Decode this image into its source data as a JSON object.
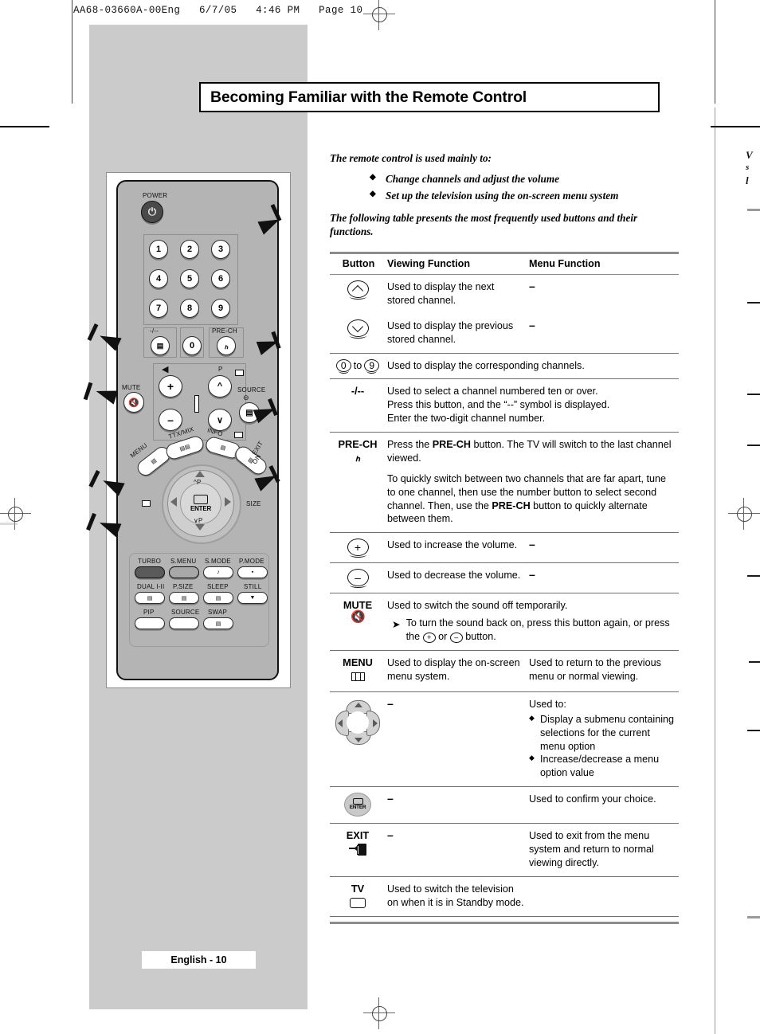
{
  "header_slug": "AA68-03660A-00Eng   6/7/05   4:46 PM   Page 10",
  "title": "Becoming Familiar with the Remote Control",
  "intro": {
    "lead": "The remote control is used mainly to:",
    "bullets": [
      "Change channels and adjust the volume",
      "Set up the television using the on-screen menu system"
    ],
    "paragraph": "The following table presents the most frequently used buttons and their functions."
  },
  "table": {
    "headers": {
      "button": "Button",
      "viewing": "Viewing Function",
      "menu": "Menu Function"
    },
    "rows": [
      {
        "icon": "channel-up-icon",
        "button_label": "",
        "viewing": "Used to display the next stored channel.",
        "menu": "–"
      },
      {
        "icon": "channel-down-icon",
        "button_label": "",
        "viewing": "Used to display the previous stored channel.",
        "menu": "–"
      },
      {
        "icon": "number-keys-icon",
        "button_label": "0 to 9",
        "viewing": "Used to display the corresponding channels.",
        "menu": ""
      },
      {
        "icon": "dash-slash-icon",
        "button_label": "-/--",
        "viewing": "Used to select a channel numbered ten or over.\nPress this button, and the “--” symbol is displayed.\nEnter the two-digit channel number.",
        "menu": ""
      },
      {
        "icon": "pre-ch-icon",
        "button_label": "PRE-CH",
        "viewing_p1_a": "Press the ",
        "viewing_p1_b": "PRE-CH",
        "viewing_p1_c": " button. The TV will switch to the last channel viewed.",
        "viewing_p2_a": "To quickly switch between two channels that are far apart, tune to one channel, then use the number button to select second channel. Then, use the ",
        "viewing_p2_b": "PRE-CH",
        "viewing_p2_c": " button to quickly alternate between them.",
        "menu": ""
      },
      {
        "icon": "volume-up-icon",
        "button_label": "",
        "viewing": "Used to increase the volume.",
        "menu": "–"
      },
      {
        "icon": "volume-down-icon",
        "button_label": "",
        "viewing": "Used to decrease the volume.",
        "menu": "–"
      },
      {
        "icon": "mute-icon",
        "button_label": "MUTE",
        "viewing": "Used to switch the sound off temporarily.",
        "note_a": "To turn the sound back on, press this button again, or press the ",
        "note_plus": "+",
        "note_or": " or ",
        "note_minus": "–",
        "note_b": " button.",
        "menu": ""
      },
      {
        "icon": "menu-icon",
        "button_label": "MENU",
        "viewing": "Used to display the on-screen menu system.",
        "menu": "Used to return to the previous menu or normal viewing."
      },
      {
        "icon": "arrow-pad-icon",
        "button_label": "",
        "viewing": "–",
        "menu_lead": "Used to:",
        "menu_bullets": [
          "Display a submenu containing selections for the current menu option",
          "Increase/decrease a menu option value"
        ]
      },
      {
        "icon": "enter-icon",
        "button_label": "",
        "viewing": "–",
        "menu": "Used to confirm your choice."
      },
      {
        "icon": "exit-icon",
        "button_label": "EXIT",
        "viewing": "–",
        "menu": "Used to exit from the menu system and return to normal viewing directly."
      },
      {
        "icon": "tv-icon",
        "button_label": "TV",
        "viewing": "Used to switch the television on when it is in Standby mode.",
        "menu": ""
      }
    ]
  },
  "remote": {
    "power_label": "POWER",
    "numeric_keys": [
      "1",
      "2",
      "3",
      "4",
      "5",
      "6",
      "7",
      "8",
      "9",
      "0"
    ],
    "dash_slash_label": "-/--",
    "pre_ch_label": "PRE-CH",
    "mute_label": "MUTE",
    "p_label": "P",
    "source_label": "SOURCE",
    "menu_label": "MENU",
    "ttx_mix_label": "TTX/MIX",
    "info_label": "INFO",
    "exit_label": "EXIT",
    "pip_on_label": "ON",
    "size_label": "SIZE",
    "enter_label": "ENTER",
    "up_p_label": "^P",
    "down_p_label": "∨P",
    "bottom_keys_row1": [
      "TURBO",
      "S.MENU",
      "S.MODE",
      "P.MODE"
    ],
    "bottom_keys_row2": [
      "DUAL I-II",
      "P.SIZE",
      "SLEEP",
      "STILL"
    ],
    "bottom_keys_row3": [
      "PIP",
      "SOURCE",
      "SWAP"
    ]
  },
  "footer": "English - 10",
  "edge_text_lines": [
    "V",
    "s",
    "l"
  ],
  "colors": {
    "page_gray": "#cbcbcb",
    "remote_body": "#b4b4b4",
    "rule_gray": "#8c8c8c",
    "text": "#000000"
  }
}
